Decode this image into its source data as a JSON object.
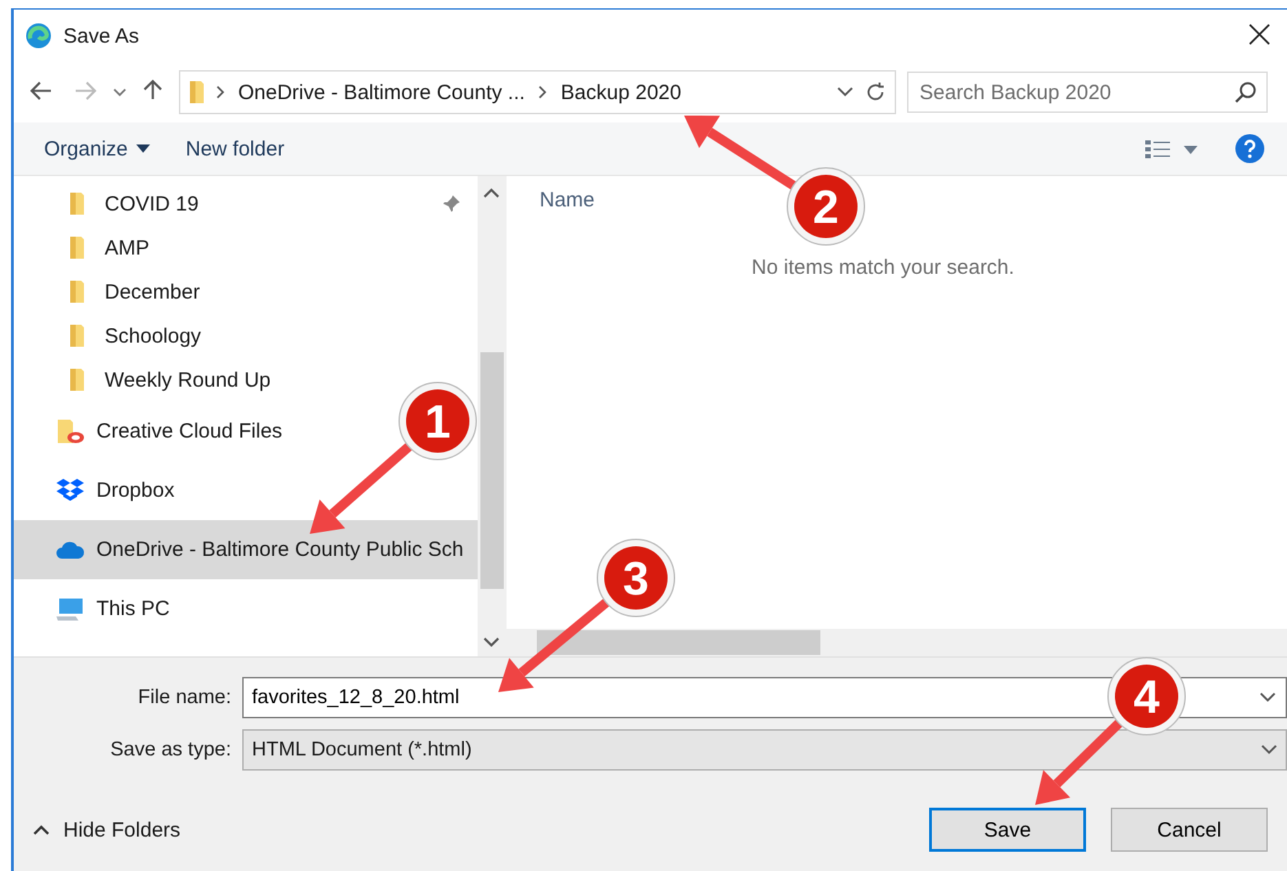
{
  "window": {
    "title": "Save As"
  },
  "address": {
    "crumbs": [
      "OneDrive - Baltimore County ...",
      "Backup 2020"
    ]
  },
  "search": {
    "placeholder": "Search Backup 2020"
  },
  "toolbar": {
    "organize": "Organize",
    "new_folder": "New folder"
  },
  "sidebar": {
    "items": [
      {
        "kind": "folder",
        "label": "COVID 19",
        "pinned": true,
        "selected": false
      },
      {
        "kind": "folder",
        "label": "AMP",
        "pinned": false,
        "selected": false
      },
      {
        "kind": "folder",
        "label": "December",
        "pinned": false,
        "selected": false
      },
      {
        "kind": "folder",
        "label": "Schoology",
        "pinned": false,
        "selected": false
      },
      {
        "kind": "folder",
        "label": "Weekly Round Up",
        "pinned": false,
        "selected": false
      },
      {
        "kind": "creative-cloud",
        "label": "Creative Cloud Files",
        "pinned": false,
        "selected": false
      },
      {
        "kind": "dropbox",
        "label": "Dropbox",
        "pinned": false,
        "selected": false
      },
      {
        "kind": "onedrive",
        "label": "OneDrive - Baltimore County Public Sch",
        "pinned": false,
        "selected": true
      },
      {
        "kind": "pc",
        "label": "This PC",
        "pinned": false,
        "selected": false
      }
    ]
  },
  "content": {
    "column": "Name",
    "empty_message": "No items match your search."
  },
  "form": {
    "file_name_label": "File name:",
    "file_name": "favorites_12_8_20.html",
    "type_label": "Save as type:",
    "type": "HTML Document (*.html)"
  },
  "hide_folders": "Hide Folders",
  "buttons": [
    {
      "label": "Save",
      "default": true
    },
    {
      "label": "Cancel",
      "default": false
    }
  ],
  "callouts": [
    {
      "label": "1"
    },
    {
      "label": "2"
    },
    {
      "label": "3"
    },
    {
      "label": "4"
    }
  ]
}
